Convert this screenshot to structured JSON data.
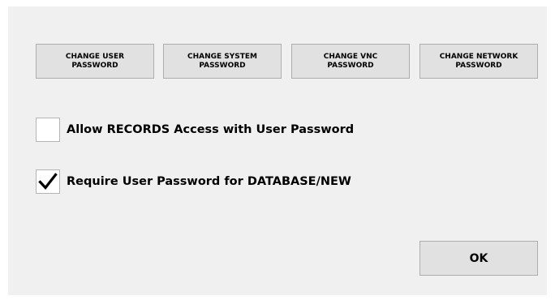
{
  "buttons": {
    "change_user_password": "CHANGE USER\nPASSWORD",
    "change_system_password": "CHANGE SYSTEM\nPASSWORD",
    "change_vnc_password": "CHANGE VNC\nPASSWORD",
    "change_network_password": "CHANGE NETWORK\nPASSWORD",
    "ok": "OK"
  },
  "options": {
    "allow_records": {
      "label": "Allow RECORDS Access with User Password",
      "checked": false
    },
    "require_user_password": {
      "label": "Require User Password for DATABASE/NEW",
      "checked": true
    }
  },
  "icons": {
    "checkmark": "check-icon"
  }
}
